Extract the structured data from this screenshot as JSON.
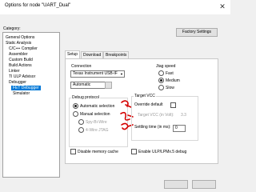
{
  "window": {
    "title": "Options for node \"UART_Dual\"",
    "close_glyph": "✕"
  },
  "category": {
    "label": "Category:",
    "items": [
      "General Options",
      "Static Analysis",
      "C/C++ Compiler",
      "Assembler",
      "Custom Build",
      "Build Actions",
      "Linker",
      "TI ULP Advisor",
      "Debugger",
      "FET Debugger",
      "Simulator"
    ],
    "selected": "FET Debugger"
  },
  "factory_button": "Factory Settings",
  "tabs": [
    "Setup",
    "Download",
    "Breakpoints"
  ],
  "active_tab": "Setup",
  "connection": {
    "label": "Connection",
    "device": "Texas Instrument USB-IF",
    "port": "Automatic"
  },
  "jtag_speed": {
    "label": "Jtag speed",
    "options": [
      "Fast",
      "Medium",
      "Slow"
    ],
    "selected": "Medium"
  },
  "debug_protocol": {
    "label": "Debug protocol",
    "options": [
      "Automatic selection",
      "Manual selection"
    ],
    "selected": "Automatic selection",
    "sub_options": [
      "Spy-Bi-Wire",
      "4-Wire JTAG"
    ]
  },
  "target_vcc": {
    "label": "Target VCC",
    "override_label": "Override default",
    "vcc_label": "Target VCC (in Volt):",
    "vcc_value": "3.3",
    "settling_label": "Settling time (in ms):",
    "settling_value": "0"
  },
  "disable_cache": "Disable memory cache",
  "ulp_debug": "Enable ULP/LPMx.5 debug",
  "annotation": {
    "color": "#d40000"
  }
}
